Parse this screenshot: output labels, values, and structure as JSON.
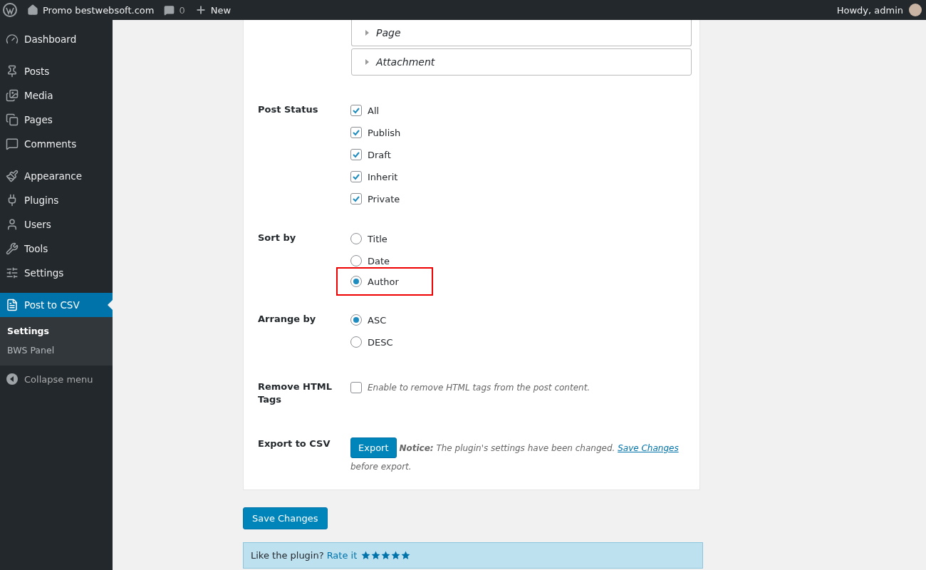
{
  "admin_bar": {
    "site": "Promo bestwebsoft.com",
    "comments": "0",
    "new": "New",
    "greeting": "Howdy, admin"
  },
  "sidebar": {
    "groups": [
      [
        {
          "label": "Dashboard",
          "selected": false
        }
      ],
      [
        {
          "label": "Posts",
          "selected": false
        },
        {
          "label": "Media",
          "selected": false
        },
        {
          "label": "Pages",
          "selected": false
        },
        {
          "label": "Comments",
          "selected": false
        }
      ],
      [
        {
          "label": "Appearance",
          "selected": false
        },
        {
          "label": "Plugins",
          "selected": false
        },
        {
          "label": "Users",
          "selected": false
        },
        {
          "label": "Tools",
          "selected": false
        },
        {
          "label": "Settings",
          "selected": false
        }
      ],
      [
        {
          "label": "Post to CSV",
          "selected": true
        }
      ]
    ],
    "submenu": [
      {
        "label": "Settings",
        "selected": true
      },
      {
        "label": "BWS Panel",
        "selected": false
      }
    ],
    "collapse": "Collapse menu"
  },
  "post_types": [
    {
      "label": "Page",
      "expanded": false
    },
    {
      "label": "Attachment",
      "expanded": false
    }
  ],
  "settings": [
    {
      "kind": "checkboxes",
      "label": "Post Status",
      "options": [
        {
          "label": "All",
          "checked": true
        },
        {
          "label": "Publish",
          "checked": true
        },
        {
          "label": "Draft",
          "checked": true
        },
        {
          "label": "Inherit",
          "checked": true
        },
        {
          "label": "Private",
          "checked": true
        }
      ]
    },
    {
      "kind": "radios",
      "label": "Sort by",
      "options": [
        {
          "label": "Title",
          "selected": false,
          "highlighted": false
        },
        {
          "label": "Date",
          "selected": false,
          "highlighted": false
        },
        {
          "label": "Author",
          "selected": true,
          "highlighted": true
        }
      ]
    },
    {
      "kind": "radios",
      "label": "Arrange by",
      "options": [
        {
          "label": "ASC",
          "selected": true,
          "highlighted": false
        },
        {
          "label": "DESC",
          "selected": false,
          "highlighted": false
        }
      ]
    },
    {
      "kind": "toggle",
      "label": "Remove HTML Tags",
      "checked": false,
      "description": "Enable to remove HTML tags from the post content."
    },
    {
      "kind": "export",
      "label": "Export to CSV",
      "button": "Export",
      "notice_label": "Notice:",
      "notice": "The plugin's settings have been changed.",
      "link": "Save Changes",
      "notice_end": "before export."
    }
  ],
  "save_button": "Save Changes",
  "rate": {
    "text": "Like the plugin?",
    "link": "Rate it",
    "stars": 5
  }
}
